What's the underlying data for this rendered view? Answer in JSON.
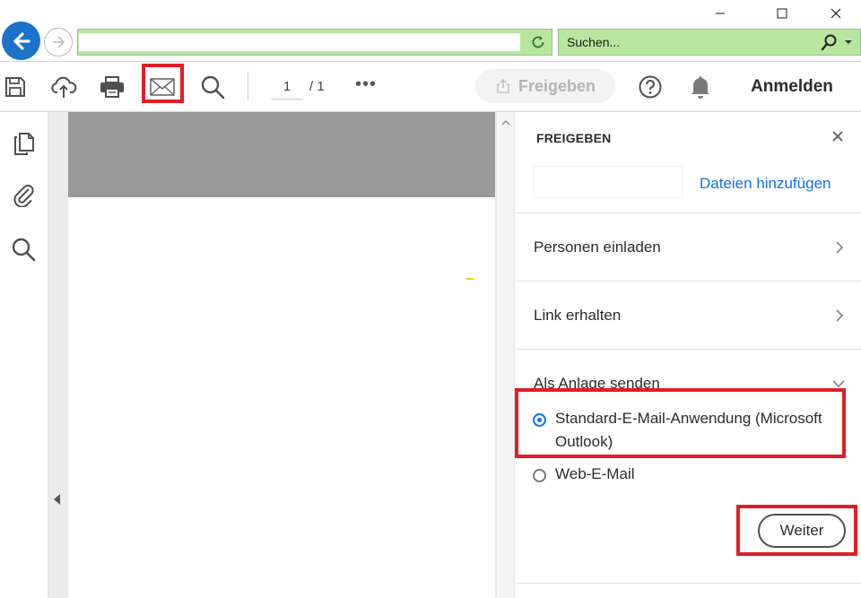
{
  "window": {
    "minimize_glyph": "–",
    "maximize_glyph": "☐",
    "close_glyph": "✕"
  },
  "browser": {
    "address_value": "",
    "search_placeholder": "Suchen...",
    "accent_color": "#b9e69e",
    "back_button_color": "#1a73c8"
  },
  "toolbar": {
    "icons": [
      "save-icon",
      "cloud-upload-icon",
      "print-icon",
      "email-icon",
      "search-icon"
    ],
    "page_current": "1",
    "page_total": "/ 1",
    "more_glyph": "•••",
    "share_label": "Freigeben",
    "signin_label": "Anmelden"
  },
  "sidebar": {
    "icons": [
      "pages-icon",
      "attachment-icon",
      "search-icon"
    ]
  },
  "panel": {
    "title": "FREIGEBEN",
    "add_files": "Dateien hinzufügen",
    "invite_label": "Personen einladen",
    "link_label": "Link erhalten",
    "attach_label": "Als Anlage senden",
    "options": [
      {
        "label": "Standard-E-Mail-Anwendung (Microsoft Outlook)",
        "selected": true
      },
      {
        "label": "Web-E-Mail",
        "selected": false
      }
    ],
    "next_label": "Weiter",
    "link_color": "#1473e6"
  },
  "highlight_color": "#e01e26"
}
